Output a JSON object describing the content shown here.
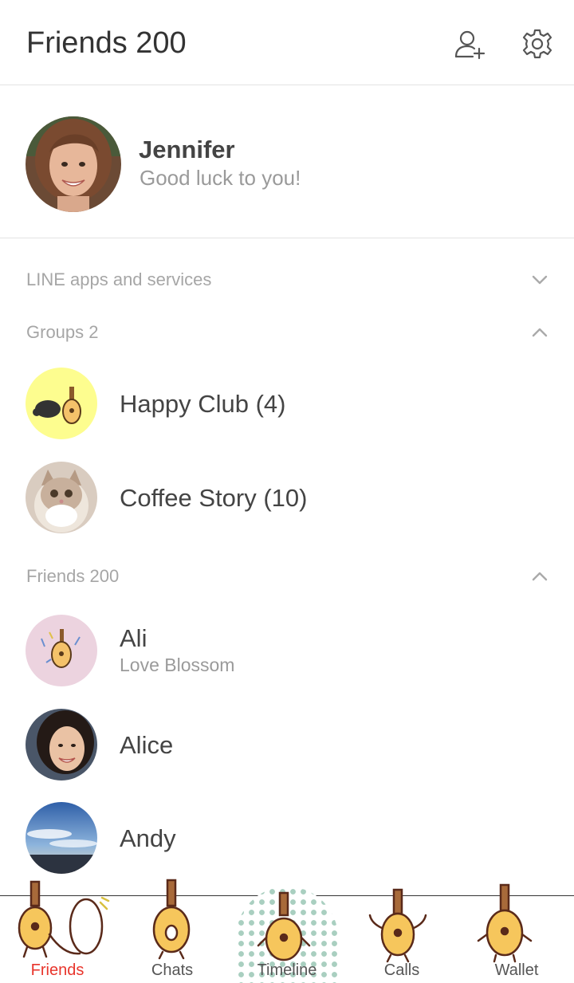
{
  "header": {
    "title": "Friends 200",
    "add_friend_icon": "add-friend-icon",
    "settings_icon": "gear-icon"
  },
  "profile": {
    "name": "Jennifer",
    "status": "Good luck to you!"
  },
  "sections": {
    "services": {
      "label": "LINE apps and services",
      "state": "collapsed"
    },
    "groups": {
      "label": "Groups 2",
      "state": "expanded"
    },
    "friends": {
      "label": "Friends 200",
      "state": "expanded"
    }
  },
  "groups": [
    {
      "name": "Happy Club (4)"
    },
    {
      "name": "Coffee Story (10)"
    }
  ],
  "friends": [
    {
      "name": "Ali",
      "status": "Love Blossom"
    },
    {
      "name": "Alice"
    },
    {
      "name": "Andy"
    }
  ],
  "tabs": [
    {
      "label": "Friends",
      "active": true
    },
    {
      "label": "Chats"
    },
    {
      "label": "Timeline"
    },
    {
      "label": "Calls"
    },
    {
      "label": "Wallet"
    }
  ],
  "colors": {
    "active_tab": "#e8352c",
    "divider": "#e3e3e3",
    "secondary_text": "#9a9a9a"
  }
}
